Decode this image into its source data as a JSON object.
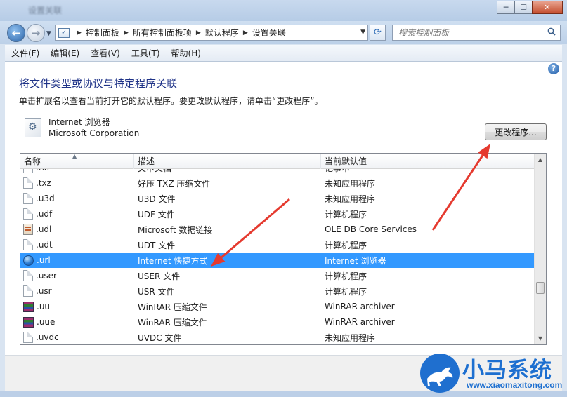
{
  "window": {
    "title": "设置关联",
    "controls": {
      "minimize": "─",
      "maximize": "☐",
      "close": "✕"
    }
  },
  "nav": {
    "back_icon": "arrow-left-icon",
    "forward_icon": "arrow-right-icon",
    "breadcrumbs": [
      "控制面板",
      "所有控制面板项",
      "默认程序",
      "设置关联"
    ],
    "search_placeholder": "搜索控制面板"
  },
  "menu": [
    "文件(F)",
    "编辑(E)",
    "查看(V)",
    "工具(T)",
    "帮助(H)"
  ],
  "page": {
    "heading": "将文件类型或协议与特定程序关联",
    "description": "单击扩展名以查看当前打开它的默认程序。要更改默认程序，请单击“更改程序”。",
    "program_name": "Internet 浏览器",
    "program_company": "Microsoft Corporation",
    "change_button": "更改程序..."
  },
  "list": {
    "columns": [
      "名称",
      "描述",
      "当前默认值"
    ],
    "rows": [
      {
        "ext": ".txt",
        "desc": "文本文档",
        "default": "记事本",
        "icon": "doc"
      },
      {
        "ext": ".txz",
        "desc": "好压 TXZ 压缩文件",
        "default": "未知应用程序",
        "icon": "doc"
      },
      {
        "ext": ".u3d",
        "desc": "U3D 文件",
        "default": "未知应用程序",
        "icon": "doc"
      },
      {
        "ext": ".udf",
        "desc": "UDF 文件",
        "default": "计算机程序",
        "icon": "doc"
      },
      {
        "ext": ".udl",
        "desc": "Microsoft 数据链接",
        "default": "OLE DB Core Services",
        "icon": "udl"
      },
      {
        "ext": ".udt",
        "desc": "UDT 文件",
        "default": "计算机程序",
        "icon": "doc"
      },
      {
        "ext": ".url",
        "desc": "Internet 快捷方式",
        "default": "Internet 浏览器",
        "icon": "globe",
        "selected": true
      },
      {
        "ext": ".user",
        "desc": "USER 文件",
        "default": "计算机程序",
        "icon": "doc"
      },
      {
        "ext": ".usr",
        "desc": "USR 文件",
        "default": "计算机程序",
        "icon": "doc"
      },
      {
        "ext": ".uu",
        "desc": "WinRAR 压缩文件",
        "default": "WinRAR archiver",
        "icon": "rar"
      },
      {
        "ext": ".uue",
        "desc": "WinRAR 压缩文件",
        "default": "WinRAR archiver",
        "icon": "rar"
      },
      {
        "ext": ".uvdc",
        "desc": "UVDC 文件",
        "default": "未知应用程序",
        "icon": "doc"
      }
    ]
  },
  "colors": {
    "heading": "#1e3287",
    "selection": "#3399ff",
    "annotation": "#e53a2f",
    "watermark": "#1d6fd0"
  },
  "watermark": {
    "text": "小马系统",
    "url": "www.xiaomaxitong.com"
  }
}
